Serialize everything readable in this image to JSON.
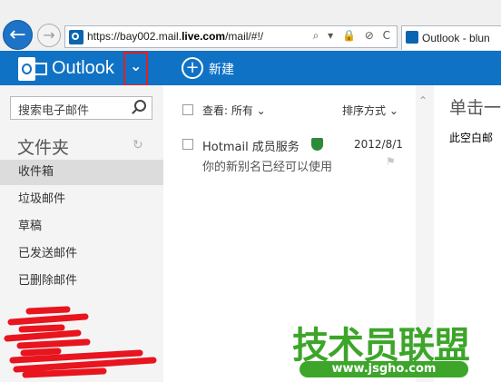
{
  "browser": {
    "url_prefix": "https://bay002.mail.",
    "url_domain": "live.com",
    "url_suffix": "/mail/#!/",
    "address_tools": "⌕ ▾ 🔒 ⊘ C",
    "tab_title": "Outlook - blun"
  },
  "header": {
    "app_name": "Outlook",
    "new_label": "新建",
    "dropdown_glyph": "⌄",
    "new_glyph": "+"
  },
  "sidebar": {
    "search_placeholder": "搜索电子邮件",
    "folders_title": "文件夹",
    "refresh_glyph": "↻",
    "items": [
      {
        "label": "收件箱",
        "active": true
      },
      {
        "label": "垃圾邮件"
      },
      {
        "label": "草稿"
      },
      {
        "label": "已发送邮件"
      },
      {
        "label": "已删除邮件"
      }
    ]
  },
  "list": {
    "view_label": "查看: 所有 ⌄",
    "sort_label": "排序方式 ⌄",
    "messages": [
      {
        "sender": "Hotmail 成员服务",
        "date": "2012/8/1",
        "preview": "你的新别名已经可以使用"
      }
    ]
  },
  "reading_pane": {
    "heading": "单击一",
    "text": "此空白邮"
  },
  "watermark": {
    "title": "技术员联盟",
    "url": "www.jsgho.com"
  },
  "colors": {
    "brand": "#0f72c5",
    "highlight_border": "#e02020",
    "watermark_green": "#3da52a"
  }
}
